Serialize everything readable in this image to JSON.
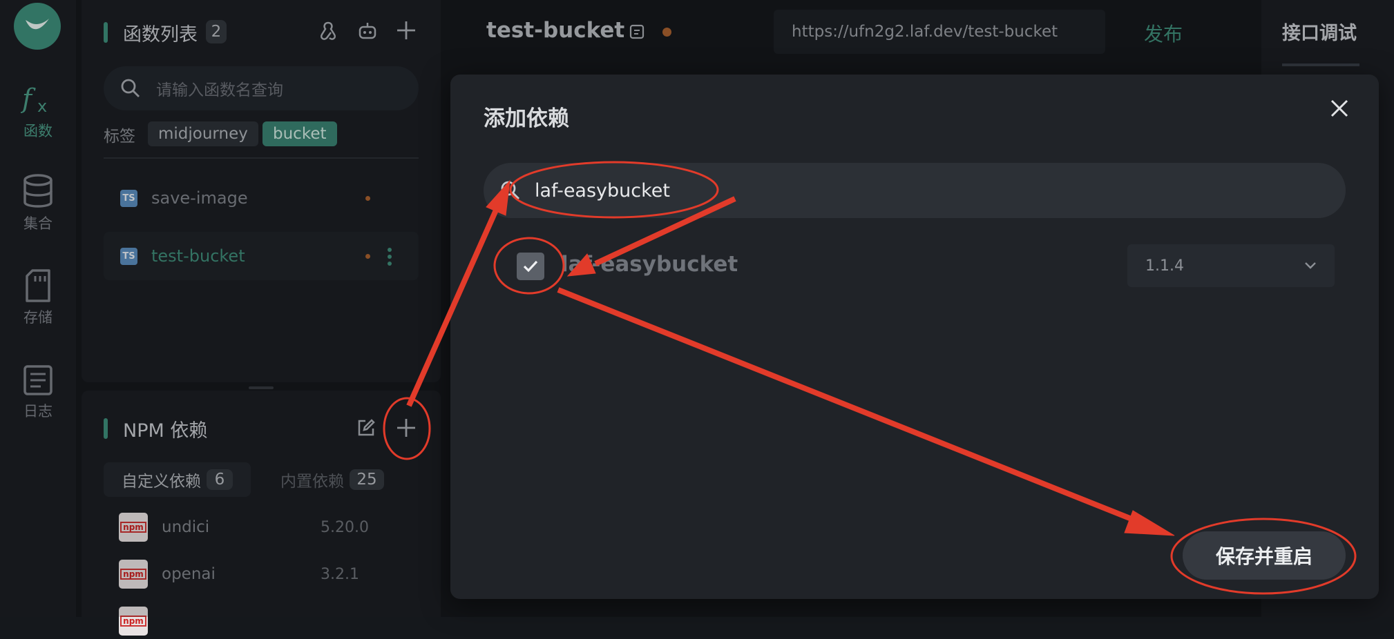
{
  "nav": {
    "items": [
      {
        "label": "函数",
        "icon": "function-icon"
      },
      {
        "label": "集合",
        "icon": "database-icon"
      },
      {
        "label": "存储",
        "icon": "storage-icon"
      },
      {
        "label": "日志",
        "icon": "log-icon"
      }
    ]
  },
  "functions": {
    "title": "函数列表",
    "count": "2",
    "search_placeholder": "请输入函数名查询",
    "tags_label": "标签",
    "tags": [
      "midjourney",
      "bucket"
    ],
    "items": [
      {
        "badge": "TS",
        "name": "save-image"
      },
      {
        "badge": "TS",
        "name": "test-bucket"
      }
    ]
  },
  "npm": {
    "title": "NPM 依赖",
    "tabs": [
      {
        "label": "自定义依赖",
        "count": "6"
      },
      {
        "label": "内置依赖",
        "count": "25"
      }
    ],
    "packages": [
      {
        "name": "undici",
        "version": "5.20.0"
      },
      {
        "name": "openai",
        "version": "3.2.1"
      }
    ]
  },
  "editor": {
    "function_name": "test-bucket",
    "url": "https://ufn2g2.laf.dev/test-bucket",
    "publish_label": "发布"
  },
  "right_panel": {
    "tab": "接口调试"
  },
  "modal": {
    "title": "添加依赖",
    "search_value": "laf-easybucket",
    "result": {
      "name": "laf-easybucket",
      "version": "1.1.4",
      "checked": true
    },
    "save_label": "保存并重启"
  },
  "colors": {
    "accent": "#3e8e7a",
    "annotation": "#e23b2a"
  }
}
